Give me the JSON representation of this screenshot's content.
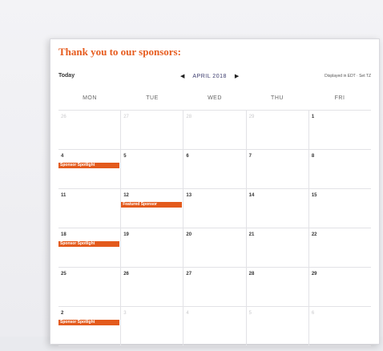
{
  "header": {
    "title": "Thank you to our sponsors:"
  },
  "toolbar": {
    "today_label": "Today",
    "prev_arrow": "◀",
    "month_label": "APRIL 2018",
    "next_arrow": "▶",
    "timezone_label": "Displayed in EDT · Set TZ"
  },
  "days": [
    "MON",
    "TUE",
    "WED",
    "THU",
    "FRI"
  ],
  "weeks": [
    {
      "days": [
        "26",
        "27",
        "28",
        "29",
        "1"
      ],
      "faded": [
        true,
        true,
        true,
        true,
        false
      ]
    },
    {
      "days": [
        "4",
        "5",
        "6",
        "7",
        "8"
      ],
      "faded": [
        false,
        false,
        false,
        false,
        false
      ]
    },
    {
      "days": [
        "11",
        "12",
        "13",
        "14",
        "15"
      ],
      "faded": [
        false,
        false,
        false,
        false,
        false
      ]
    },
    {
      "days": [
        "18",
        "19",
        "20",
        "21",
        "22"
      ],
      "faded": [
        false,
        false,
        false,
        false,
        false
      ]
    },
    {
      "days": [
        "25",
        "26",
        "27",
        "28",
        "29"
      ],
      "faded": [
        false,
        false,
        false,
        false,
        false
      ]
    },
    {
      "days": [
        "2",
        "3",
        "4",
        "5",
        "6"
      ],
      "faded": [
        false,
        true,
        true,
        true,
        true
      ]
    }
  ],
  "events": {
    "week2_mon": "Sponsor Spotlight",
    "week3_tue": "Featured Sponsor",
    "week4_mon": "Sponsor Spotlight",
    "week6_mon": "Sponsor Spotlight"
  },
  "colors": {
    "accent": "#e35a1c",
    "title": "#e65c1f"
  }
}
